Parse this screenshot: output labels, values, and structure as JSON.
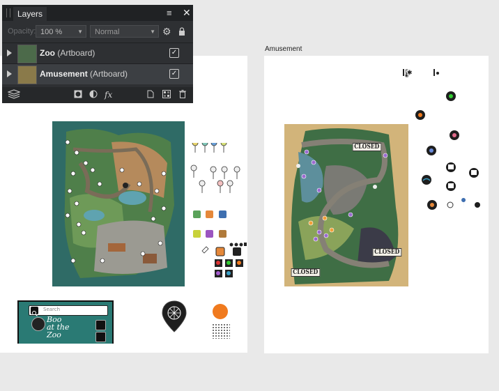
{
  "layers_panel": {
    "tab_label": "Layers",
    "opacity_label": "Opacity:",
    "opacity_value": "100 %",
    "blend_mode": "Normal",
    "layers": [
      {
        "name": "Zoo",
        "type": "(Artboard)",
        "visible": true
      },
      {
        "name": "Amusement",
        "type": "(Artboard)",
        "visible": true
      }
    ],
    "icons": [
      "menu-icon",
      "close-icon",
      "gear-icon",
      "lock-icon",
      "layers-stack-icon",
      "mask-icon",
      "adjustment-icon",
      "fx-icon",
      "new-layer-icon",
      "group-icon",
      "delete-icon"
    ],
    "fx_label": "fx"
  },
  "artboards": {
    "amusement_label": "Amusement"
  },
  "zoo_mockup": {
    "search_placeholder": "Search",
    "title": "Boo\nat the\nZoo"
  },
  "amusement_map": {
    "closed_signs": [
      "CLOSED",
      "CLOSED",
      "CLOSED"
    ]
  },
  "colors": {
    "panel_bg": "#2e3033",
    "orange_accent": "#f07a1e",
    "map_teal": "#2f6b66",
    "map_sand": "#d2b47a"
  }
}
